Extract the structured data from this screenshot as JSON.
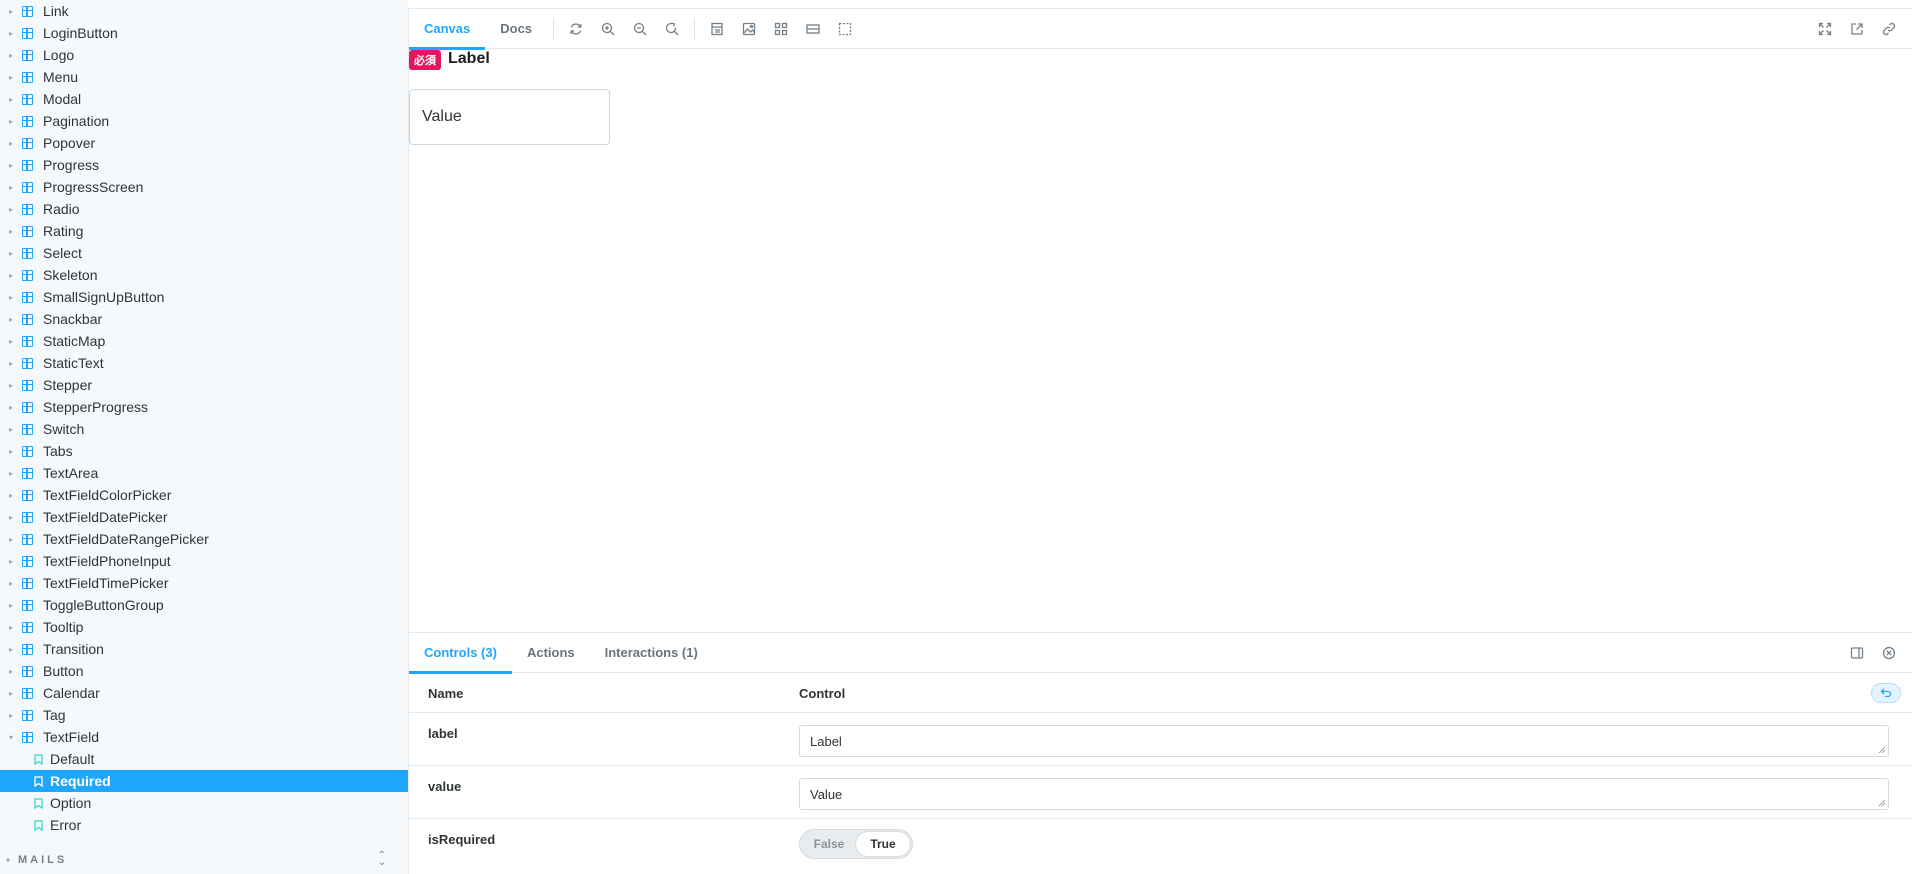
{
  "sidebar": {
    "components": [
      "Link",
      "LoginButton",
      "Logo",
      "Menu",
      "Modal",
      "Pagination",
      "Popover",
      "Progress",
      "ProgressScreen",
      "Radio",
      "Rating",
      "Select",
      "Skeleton",
      "SmallSignUpButton",
      "Snackbar",
      "StaticMap",
      "StaticText",
      "Stepper",
      "StepperProgress",
      "Switch",
      "Tabs",
      "TextArea",
      "TextFieldColorPicker",
      "TextFieldDatePicker",
      "TextFieldDateRangePicker",
      "TextFieldPhoneInput",
      "TextFieldTimePicker",
      "ToggleButtonGroup",
      "Tooltip",
      "Transition",
      "Button",
      "Calendar",
      "Tag",
      "TextField"
    ],
    "stories": [
      "Default",
      "Required",
      "Option",
      "Error"
    ],
    "selected_story": "Required",
    "section_label": "MAILS"
  },
  "toolbar": {
    "tabs": [
      "Canvas",
      "Docs"
    ],
    "active_tab": "Canvas",
    "icons": [
      "reload-icon",
      "zoom-in-icon",
      "zoom-out-icon",
      "zoom-reset-icon",
      "background-icon",
      "image-icon",
      "grid-icon",
      "measure-icon",
      "outline-icon"
    ],
    "right_icons": [
      "fullscreen-icon",
      "open-new-tab-icon",
      "copy-link-icon"
    ]
  },
  "preview": {
    "badge": "必須",
    "label": "Label",
    "value": "Value"
  },
  "addons": {
    "tabs": [
      "Controls (3)",
      "Actions",
      "Interactions (1)"
    ],
    "active_tab": "Controls (3)",
    "header_name": "Name",
    "header_control": "Control",
    "rows": [
      {
        "name": "label",
        "value": "Label"
      },
      {
        "name": "value",
        "value": "Value"
      },
      {
        "name": "isRequired",
        "false_label": "False",
        "true_label": "True",
        "selected": "True"
      }
    ]
  },
  "colors": {
    "accent": "#1ea7fd",
    "badge": "#e0185f"
  }
}
